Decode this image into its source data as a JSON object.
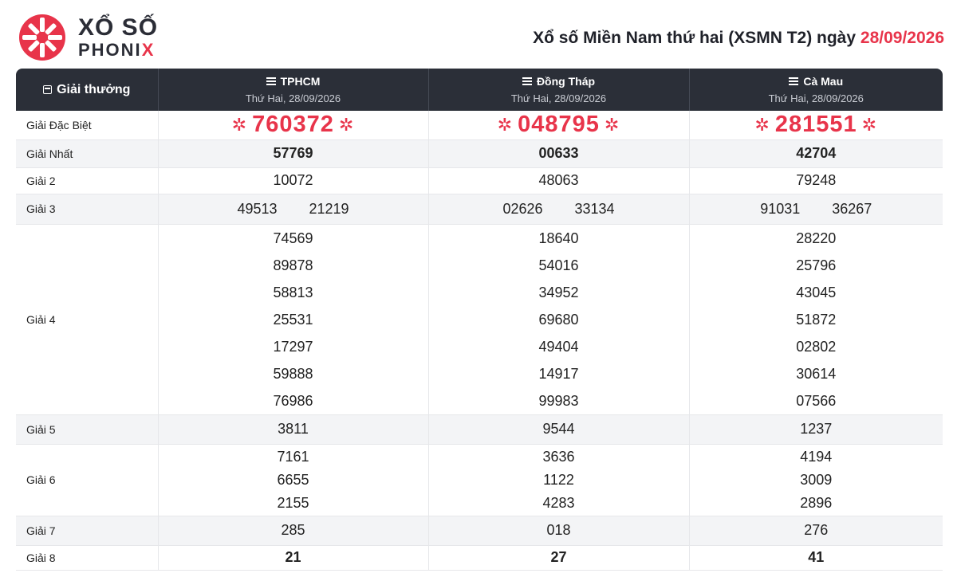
{
  "brand": {
    "line1": "XỔ SỐ",
    "line2_main": "PHONI",
    "line2_accent": "X"
  },
  "title": {
    "text": "Xổ số Miền Nam thứ hai (XSMN T2) ngày ",
    "date": "28/09/2026"
  },
  "header": {
    "prize_label": "Giải thưởng",
    "provinces": [
      {
        "name": "TPHCM",
        "date": "Thứ Hai, 28/09/2026"
      },
      {
        "name": "Đồng Tháp",
        "date": "Thứ Hai, 28/09/2026"
      },
      {
        "name": "Cà Mau",
        "date": "Thứ Hai, 28/09/2026"
      }
    ]
  },
  "labels": {
    "db": "Giải Đặc Biệt",
    "nhat": "Giải Nhất",
    "g2": "Giải 2",
    "g3": "Giải 3",
    "g4": "Giải 4",
    "g5": "Giải 5",
    "g6": "Giải 6",
    "g7": "Giải 7",
    "g8": "Giải 8"
  },
  "results": [
    {
      "db": "760372",
      "nhat": "57769",
      "g2": "10072",
      "g3": [
        "49513",
        "21219"
      ],
      "g4": [
        "74569",
        "89878",
        "58813",
        "25531",
        "17297",
        "59888",
        "76986"
      ],
      "g5": "3811",
      "g6": [
        "7161",
        "6655",
        "2155"
      ],
      "g7": "285",
      "g8": "21"
    },
    {
      "db": "048795",
      "nhat": "00633",
      "g2": "48063",
      "g3": [
        "02626",
        "33134"
      ],
      "g4": [
        "18640",
        "54016",
        "34952",
        "69680",
        "49404",
        "14917",
        "99983"
      ],
      "g5": "9544",
      "g6": [
        "3636",
        "1122",
        "4283"
      ],
      "g7": "018",
      "g8": "27"
    },
    {
      "db": "281551",
      "nhat": "42704",
      "g2": "79248",
      "g3": [
        "91031",
        "36267"
      ],
      "g4": [
        "28220",
        "25796",
        "43045",
        "51872",
        "02802",
        "30614",
        "07566"
      ],
      "g5": "1237",
      "g6": [
        "4194",
        "3009",
        "2896"
      ],
      "g7": "276",
      "g8": "41"
    }
  ],
  "colors": {
    "accent": "#e8344a",
    "header_bg": "#2b2f38",
    "alt_row": "#f3f4f6"
  },
  "icons": {
    "logo": "phonix-star-logo",
    "calendar": "calendar-icon",
    "list": "list-icon",
    "special": "asterisk-icon"
  }
}
